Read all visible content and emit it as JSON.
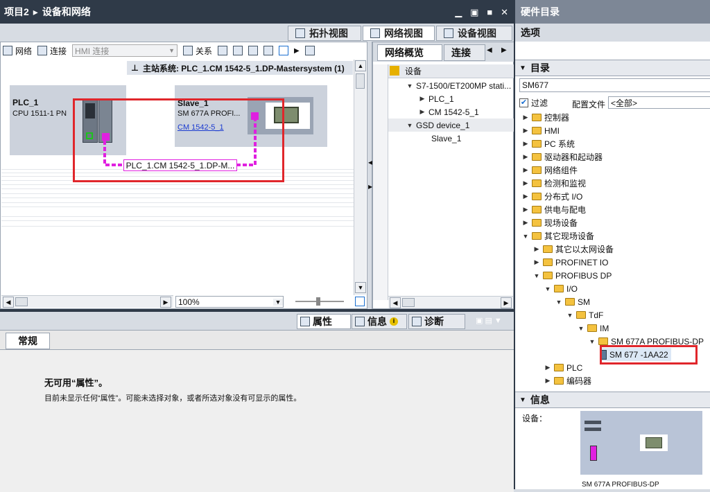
{
  "title_bar": {
    "project": "项目2",
    "separator": "▸",
    "page": "设备和网络"
  },
  "view_tabs": {
    "topology": "拓扑视图",
    "network": "网络视图",
    "device": "设备视图"
  },
  "toolbar": {
    "network": "网络",
    "connect": "连接",
    "hmi_connect": "HMI 连接",
    "relation": "关系"
  },
  "master_system": {
    "label": "主站系统: PLC_1.CM 1542-5_1.DP-Mastersystem (1)"
  },
  "plc": {
    "name": "PLC_1",
    "cpu": "CPU 1511-1 PN"
  },
  "slave": {
    "name": "Slave_1",
    "model": "SM 677A PROFI...",
    "link": "CM 1542-5_1"
  },
  "bus_label": "PLC_1.CM 1542-5_1.DP-M...",
  "zoom": "100%",
  "overview": {
    "tabs": [
      "网络概览",
      "连接"
    ],
    "column": "设备",
    "rows": [
      {
        "text": "S7-1500/ET200MP stati...",
        "level": 0,
        "expanded": true
      },
      {
        "text": "PLC_1",
        "level": 1,
        "expanded": false
      },
      {
        "text": "CM 1542-5_1",
        "level": 1,
        "expanded": false
      },
      {
        "text": "GSD device_1",
        "level": 0,
        "expanded": true
      },
      {
        "text": "Slave_1",
        "level": 1,
        "expanded": null
      }
    ]
  },
  "props": {
    "tabs": [
      "属性",
      "信息",
      "诊断"
    ],
    "subtab": "常规",
    "title": "无可用“属性”。",
    "desc": "目前未显示任何“属性”。可能未选择对象，或者所选对象没有可显示的属性。"
  },
  "catalog": {
    "title": "硬件目录",
    "options": "选项",
    "section": "目录",
    "search": "SM677",
    "filter": "过滤",
    "profile_label": "配置文件",
    "profile_value": "<全部>",
    "tree": [
      {
        "label": "控制器",
        "level": 0,
        "state": "closed"
      },
      {
        "label": "HMI",
        "level": 0,
        "state": "closed"
      },
      {
        "label": "PC 系统",
        "level": 0,
        "state": "closed"
      },
      {
        "label": "驱动器和起动器",
        "level": 0,
        "state": "closed"
      },
      {
        "label": "网络组件",
        "level": 0,
        "state": "closed"
      },
      {
        "label": "检测和监视",
        "level": 0,
        "state": "closed"
      },
      {
        "label": "分布式 I/O",
        "level": 0,
        "state": "closed"
      },
      {
        "label": "供电与配电",
        "level": 0,
        "state": "closed"
      },
      {
        "label": "现场设备",
        "level": 0,
        "state": "closed"
      },
      {
        "label": "其它现场设备",
        "level": 0,
        "state": "open"
      },
      {
        "label": "其它以太网设备",
        "level": 1,
        "state": "closed"
      },
      {
        "label": "PROFINET IO",
        "level": 1,
        "state": "closed"
      },
      {
        "label": "PROFIBUS DP",
        "level": 1,
        "state": "open"
      },
      {
        "label": "I/O",
        "level": 2,
        "state": "open"
      },
      {
        "label": "SM",
        "level": 3,
        "state": "open"
      },
      {
        "label": "TdF",
        "level": 4,
        "state": "open"
      },
      {
        "label": "IM",
        "level": 5,
        "state": "open"
      },
      {
        "label": "SM 677A PROFIBUS-DP",
        "level": 6,
        "state": "open"
      },
      {
        "label": "SM 677 -1AA22",
        "level": 7,
        "state": "leaf"
      },
      {
        "label": "PLC",
        "level": 2,
        "state": "closed"
      },
      {
        "label": "编码器",
        "level": 2,
        "state": "closed"
      }
    ]
  },
  "info": {
    "title": "信息",
    "device_label": "设备：",
    "device_name": "SM 677A PROFIBUS-DP"
  },
  "colors": {
    "header": "#2f3a48",
    "highlight": "#e0262b",
    "bus": "#e020e0",
    "accent": "#1a6fd0"
  }
}
